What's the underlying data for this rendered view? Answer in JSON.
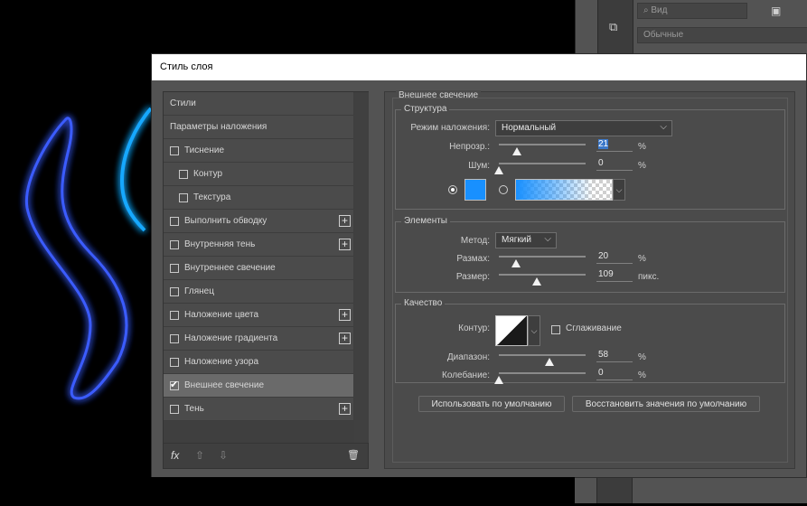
{
  "colors": {
    "glow_blue": "#1f6bff",
    "glow_cyan": "#1aa7ff",
    "swatch": "#1890ff",
    "dialog_bg": "#535353"
  },
  "right_panel": {
    "search_placeholder": "Вид",
    "blend_mode": "Обычные"
  },
  "dialog": {
    "title": "Стиль слоя",
    "styles_list": [
      {
        "label": "Стили",
        "checkbox": false,
        "checked": false,
        "plus": false,
        "indent": false,
        "selected": false
      },
      {
        "label": "Параметры наложения",
        "checkbox": false,
        "checked": false,
        "plus": false,
        "indent": false,
        "selected": false
      },
      {
        "label": "Тиснение",
        "checkbox": true,
        "checked": false,
        "plus": false,
        "indent": false,
        "selected": false
      },
      {
        "label": "Контур",
        "checkbox": true,
        "checked": false,
        "plus": false,
        "indent": true,
        "selected": false
      },
      {
        "label": "Текстура",
        "checkbox": true,
        "checked": false,
        "plus": false,
        "indent": true,
        "selected": false
      },
      {
        "label": "Выполнить обводку",
        "checkbox": true,
        "checked": false,
        "plus": true,
        "indent": false,
        "selected": false
      },
      {
        "label": "Внутренняя тень",
        "checkbox": true,
        "checked": false,
        "plus": true,
        "indent": false,
        "selected": false
      },
      {
        "label": "Внутреннее свечение",
        "checkbox": true,
        "checked": false,
        "plus": false,
        "indent": false,
        "selected": false
      },
      {
        "label": "Глянец",
        "checkbox": true,
        "checked": false,
        "plus": false,
        "indent": false,
        "selected": false
      },
      {
        "label": "Наложение цвета",
        "checkbox": true,
        "checked": false,
        "plus": true,
        "indent": false,
        "selected": false
      },
      {
        "label": "Наложение градиента",
        "checkbox": true,
        "checked": false,
        "plus": true,
        "indent": false,
        "selected": false
      },
      {
        "label": "Наложение узора",
        "checkbox": true,
        "checked": false,
        "plus": false,
        "indent": false,
        "selected": false
      },
      {
        "label": "Внешнее свечение",
        "checkbox": true,
        "checked": true,
        "plus": false,
        "indent": false,
        "selected": true
      },
      {
        "label": "Тень",
        "checkbox": true,
        "checked": false,
        "plus": true,
        "indent": false,
        "selected": false
      }
    ],
    "bottom": {
      "fx": "fx",
      "up": "⇧",
      "down": "⇩",
      "trash": "🗑"
    },
    "panel_title": "Внешнее свечение",
    "structure": {
      "title": "Структура",
      "blend_label": "Режим наложения:",
      "blend_value": "Нормальный",
      "opacity_label": "Непрозр.:",
      "opacity_value": "21",
      "opacity_pct": 21,
      "noise_label": "Шум:",
      "noise_value": "0",
      "noise_pct": 0,
      "unit": "%"
    },
    "elements": {
      "title": "Элементы",
      "method_label": "Метод:",
      "method_value": "Мягкий",
      "spread_label": "Размах:",
      "spread_value": "20",
      "spread_pct": 20,
      "size_label": "Размер:",
      "size_value": "109",
      "size_pct": 44,
      "size_unit": "пикс.",
      "unit": "%"
    },
    "quality": {
      "title": "Качество",
      "contour_label": "Контур:",
      "antialias_label": "Сглаживание",
      "range_label": "Диапазон:",
      "range_value": "58",
      "range_pct": 58,
      "jitter_label": "Колебание:",
      "jitter_value": "0",
      "jitter_pct": 0,
      "unit": "%"
    },
    "buttons": {
      "default": "Использовать по умолчанию",
      "reset": "Восстановить значения по умолчанию"
    }
  }
}
